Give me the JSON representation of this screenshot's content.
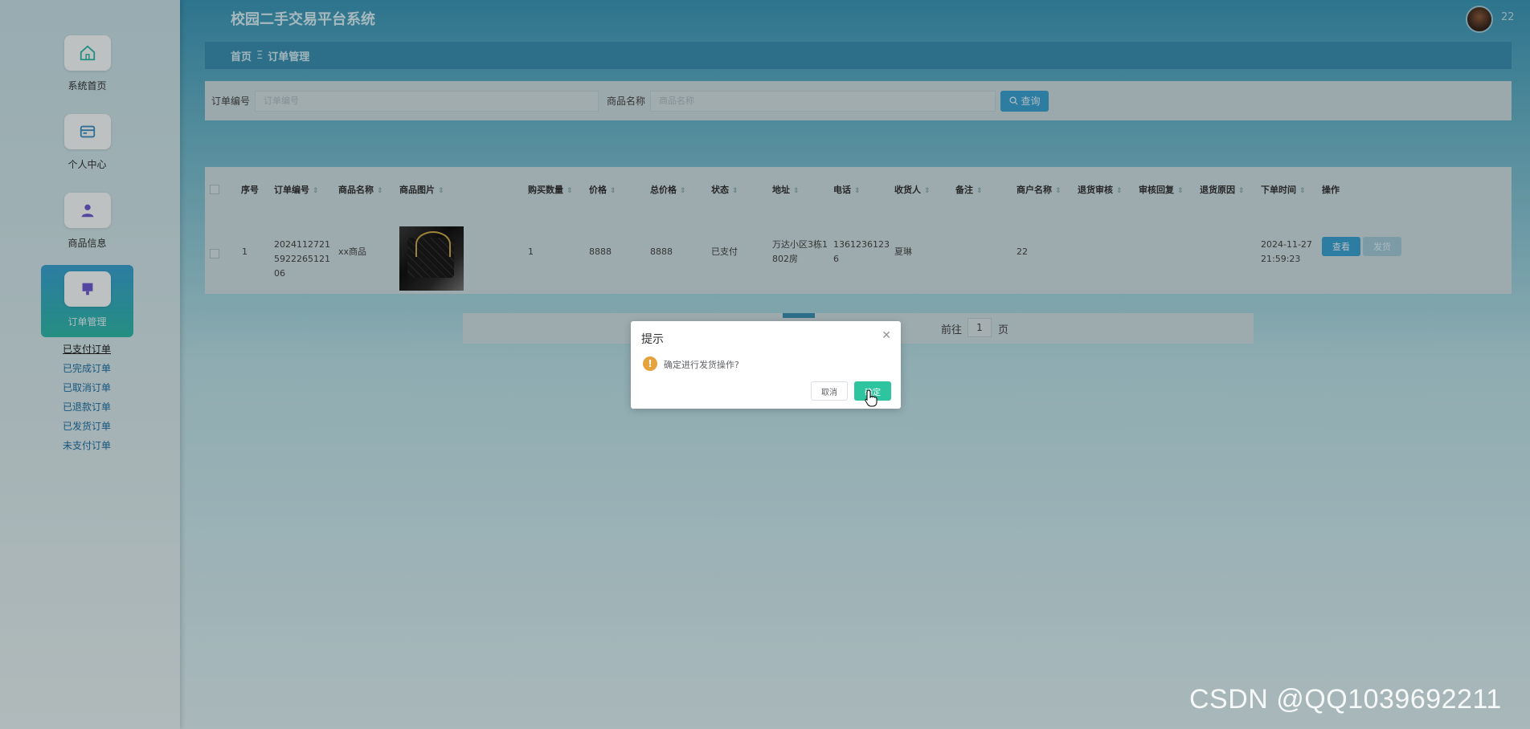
{
  "app": {
    "title": "校园二手交易平台系统",
    "user_name": "22"
  },
  "sidebar": {
    "items": [
      {
        "label": "系统首页",
        "icon": "home-icon"
      },
      {
        "label": "个人中心",
        "icon": "wallet-icon"
      },
      {
        "label": "商品信息",
        "icon": "user-icon"
      },
      {
        "label": "订单管理",
        "icon": "order-icon",
        "active": true
      }
    ],
    "submenu": [
      "已支付订单",
      "已完成订单",
      "已取消订单",
      "已退款订单",
      "已发货订单",
      "未支付订单"
    ]
  },
  "breadcrumb": {
    "home": "首页",
    "separator": "Ξ",
    "current": "订单管理"
  },
  "search": {
    "order_no_label": "订单编号",
    "order_no_placeholder": "订单编号",
    "product_label": "商品名称",
    "product_placeholder": "商品名称",
    "button_label": "查询"
  },
  "table": {
    "headers": [
      "序号",
      "订单编号",
      "商品名称",
      "商品图片",
      "购买数量",
      "价格",
      "总价格",
      "状态",
      "地址",
      "电话",
      "收货人",
      "备注",
      "商户名称",
      "退货审核",
      "审核回复",
      "退货原因",
      "下单时间",
      "操作"
    ],
    "row": {
      "index": "1",
      "order_no": "2024112721592226512106",
      "product_name": "xx商品",
      "quantity": "1",
      "price": "8888",
      "total": "8888",
      "status": "已支付",
      "address": "万达小区3栋1802房",
      "phone": "13612361236",
      "receiver": "夏琳",
      "remark": "",
      "merchant": "22",
      "order_time": "2024-11-27 21:59:23",
      "view_label": "查看",
      "ship_label": "发货"
    }
  },
  "pagination": {
    "goto_label": "前往",
    "page": "1",
    "page_unit": "页"
  },
  "dialog": {
    "title": "提示",
    "message": "确定进行发货操作?",
    "cancel_label": "取消",
    "confirm_label": "确定"
  },
  "watermark": "CSDN @QQ1039692211",
  "colors": {
    "primary": "#3a9fd0",
    "confirm": "#2ec4a0",
    "warning": "#e6a23c"
  }
}
